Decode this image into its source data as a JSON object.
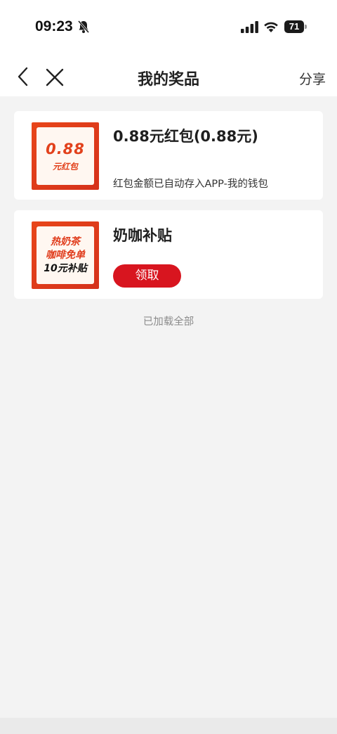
{
  "status_bar": {
    "time": "09:23",
    "battery": "71",
    "icons": [
      "bell-muted-icon",
      "signal-icon",
      "wifi-icon",
      "battery-icon"
    ]
  },
  "nav": {
    "title": "我的奖品",
    "share_label": "分享",
    "icons": [
      "back-icon",
      "close-icon"
    ]
  },
  "prizes": [
    {
      "title": "0.88元红包(0.88元)",
      "description": "红包金额已自动存入APP-我的钱包",
      "thumb_amount": "0.88",
      "thumb_label": "元红包"
    },
    {
      "title": "奶咖补贴",
      "action_label": "领取",
      "thumb_lines": [
        "热奶茶",
        "咖啡免单",
        "10元补贴"
      ]
    }
  ],
  "footer": {
    "loaded_all": "已加载全部"
  },
  "colors": {
    "accent_red": "#d8151f",
    "thumb_orange": "#e2411c",
    "background": "#f3f3f3"
  }
}
